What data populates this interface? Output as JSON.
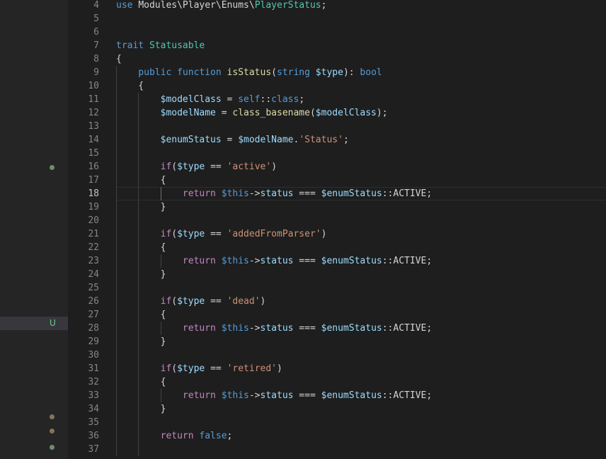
{
  "explorer": {
    "selected_status_letter": "U",
    "colors": {
      "modified": "#6b8e6b",
      "untracked": "#73c991",
      "warning": "#857458"
    }
  },
  "editor": {
    "active_line": 18,
    "lines": [
      {
        "n": "4",
        "tokens": [
          {
            "t": "use ",
            "c": "#569cd6"
          },
          {
            "t": "Modules\\Player\\Enums\\",
            "c": "#d4d4d4"
          },
          {
            "t": "PlayerStatus",
            "c": "#4ec9b0"
          },
          {
            "t": ";",
            "c": "#d4d4d4"
          }
        ]
      },
      {
        "n": "5",
        "tokens": []
      },
      {
        "n": "6",
        "tokens": []
      },
      {
        "n": "7",
        "tokens": [
          {
            "t": "trait ",
            "c": "#569cd6"
          },
          {
            "t": "Statusable",
            "c": "#4ec9b0"
          }
        ]
      },
      {
        "n": "8",
        "tokens": [
          {
            "t": "{",
            "c": "#d4d4d4"
          }
        ]
      },
      {
        "n": "9",
        "tokens": [
          {
            "t": "    public ",
            "c": "#569cd6"
          },
          {
            "t": "function ",
            "c": "#569cd6"
          },
          {
            "t": "isStatus",
            "c": "#dcdcaa"
          },
          {
            "t": "(",
            "c": "#d4d4d4"
          },
          {
            "t": "string ",
            "c": "#569cd6"
          },
          {
            "t": "$type",
            "c": "#9cdcfe"
          },
          {
            "t": "): ",
            "c": "#d4d4d4"
          },
          {
            "t": "bool",
            "c": "#569cd6"
          }
        ]
      },
      {
        "n": "10",
        "tokens": [
          {
            "t": "    {",
            "c": "#d4d4d4"
          }
        ]
      },
      {
        "n": "11",
        "tokens": [
          {
            "t": "        $modelClass",
            "c": "#9cdcfe"
          },
          {
            "t": " = ",
            "c": "#d4d4d4"
          },
          {
            "t": "self",
            "c": "#569cd6"
          },
          {
            "t": "::",
            "c": "#d4d4d4"
          },
          {
            "t": "class",
            "c": "#569cd6"
          },
          {
            "t": ";",
            "c": "#d4d4d4"
          }
        ]
      },
      {
        "n": "12",
        "tokens": [
          {
            "t": "        $modelName",
            "c": "#9cdcfe"
          },
          {
            "t": " = ",
            "c": "#d4d4d4"
          },
          {
            "t": "class_basename",
            "c": "#dcdcaa"
          },
          {
            "t": "(",
            "c": "#d4d4d4"
          },
          {
            "t": "$modelClass",
            "c": "#9cdcfe"
          },
          {
            "t": ");",
            "c": "#d4d4d4"
          }
        ]
      },
      {
        "n": "13",
        "tokens": []
      },
      {
        "n": "14",
        "tokens": [
          {
            "t": "        $enumStatus",
            "c": "#9cdcfe"
          },
          {
            "t": " = ",
            "c": "#d4d4d4"
          },
          {
            "t": "$modelName",
            "c": "#9cdcfe"
          },
          {
            "t": ".",
            "c": "#d4d4d4"
          },
          {
            "t": "'Status'",
            "c": "#ce9178"
          },
          {
            "t": ";",
            "c": "#d4d4d4"
          }
        ]
      },
      {
        "n": "15",
        "tokens": []
      },
      {
        "n": "16",
        "tokens": [
          {
            "t": "        if",
            "c": "#c586c0"
          },
          {
            "t": "(",
            "c": "#d4d4d4"
          },
          {
            "t": "$type",
            "c": "#9cdcfe"
          },
          {
            "t": " == ",
            "c": "#d4d4d4"
          },
          {
            "t": "'active'",
            "c": "#ce9178"
          },
          {
            "t": ")",
            "c": "#d4d4d4"
          }
        ]
      },
      {
        "n": "17",
        "tokens": [
          {
            "t": "        {",
            "c": "#d4d4d4"
          }
        ]
      },
      {
        "n": "18",
        "tokens": [
          {
            "t": "            return ",
            "c": "#c586c0"
          },
          {
            "t": "$this",
            "c": "#569cd6"
          },
          {
            "t": "->",
            "c": "#d4d4d4"
          },
          {
            "t": "status",
            "c": "#9cdcfe"
          },
          {
            "t": " === ",
            "c": "#d4d4d4"
          },
          {
            "t": "$enumStatus",
            "c": "#9cdcfe"
          },
          {
            "t": "::ACTIVE;",
            "c": "#d4d4d4"
          }
        ]
      },
      {
        "n": "19",
        "tokens": [
          {
            "t": "        }",
            "c": "#d4d4d4"
          }
        ]
      },
      {
        "n": "20",
        "tokens": []
      },
      {
        "n": "21",
        "tokens": [
          {
            "t": "        if",
            "c": "#c586c0"
          },
          {
            "t": "(",
            "c": "#d4d4d4"
          },
          {
            "t": "$type",
            "c": "#9cdcfe"
          },
          {
            "t": " == ",
            "c": "#d4d4d4"
          },
          {
            "t": "'addedFromParser'",
            "c": "#ce9178"
          },
          {
            "t": ")",
            "c": "#d4d4d4"
          }
        ]
      },
      {
        "n": "22",
        "tokens": [
          {
            "t": "        {",
            "c": "#d4d4d4"
          }
        ]
      },
      {
        "n": "23",
        "tokens": [
          {
            "t": "            return ",
            "c": "#c586c0"
          },
          {
            "t": "$this",
            "c": "#569cd6"
          },
          {
            "t": "->",
            "c": "#d4d4d4"
          },
          {
            "t": "status",
            "c": "#9cdcfe"
          },
          {
            "t": " === ",
            "c": "#d4d4d4"
          },
          {
            "t": "$enumStatus",
            "c": "#9cdcfe"
          },
          {
            "t": "::ACTIVE;",
            "c": "#d4d4d4"
          }
        ]
      },
      {
        "n": "24",
        "tokens": [
          {
            "t": "        }",
            "c": "#d4d4d4"
          }
        ]
      },
      {
        "n": "25",
        "tokens": []
      },
      {
        "n": "26",
        "tokens": [
          {
            "t": "        if",
            "c": "#c586c0"
          },
          {
            "t": "(",
            "c": "#d4d4d4"
          },
          {
            "t": "$type",
            "c": "#9cdcfe"
          },
          {
            "t": " == ",
            "c": "#d4d4d4"
          },
          {
            "t": "'dead'",
            "c": "#ce9178"
          },
          {
            "t": ")",
            "c": "#d4d4d4"
          }
        ]
      },
      {
        "n": "27",
        "tokens": [
          {
            "t": "        {",
            "c": "#d4d4d4"
          }
        ]
      },
      {
        "n": "28",
        "tokens": [
          {
            "t": "            return ",
            "c": "#c586c0"
          },
          {
            "t": "$this",
            "c": "#569cd6"
          },
          {
            "t": "->",
            "c": "#d4d4d4"
          },
          {
            "t": "status",
            "c": "#9cdcfe"
          },
          {
            "t": " === ",
            "c": "#d4d4d4"
          },
          {
            "t": "$enumStatus",
            "c": "#9cdcfe"
          },
          {
            "t": "::ACTIVE;",
            "c": "#d4d4d4"
          }
        ]
      },
      {
        "n": "29",
        "tokens": [
          {
            "t": "        }",
            "c": "#d4d4d4"
          }
        ]
      },
      {
        "n": "30",
        "tokens": []
      },
      {
        "n": "31",
        "tokens": [
          {
            "t": "        if",
            "c": "#c586c0"
          },
          {
            "t": "(",
            "c": "#d4d4d4"
          },
          {
            "t": "$type",
            "c": "#9cdcfe"
          },
          {
            "t": " == ",
            "c": "#d4d4d4"
          },
          {
            "t": "'retired'",
            "c": "#ce9178"
          },
          {
            "t": ")",
            "c": "#d4d4d4"
          }
        ]
      },
      {
        "n": "32",
        "tokens": [
          {
            "t": "        {",
            "c": "#d4d4d4"
          }
        ]
      },
      {
        "n": "33",
        "tokens": [
          {
            "t": "            return ",
            "c": "#c586c0"
          },
          {
            "t": "$this",
            "c": "#569cd6"
          },
          {
            "t": "->",
            "c": "#d4d4d4"
          },
          {
            "t": "status",
            "c": "#9cdcfe"
          },
          {
            "t": " === ",
            "c": "#d4d4d4"
          },
          {
            "t": "$enumStatus",
            "c": "#9cdcfe"
          },
          {
            "t": "::ACTIVE;",
            "c": "#d4d4d4"
          }
        ]
      },
      {
        "n": "34",
        "tokens": [
          {
            "t": "        }",
            "c": "#d4d4d4"
          }
        ]
      },
      {
        "n": "35",
        "tokens": []
      },
      {
        "n": "36",
        "tokens": [
          {
            "t": "        return ",
            "c": "#c586c0"
          },
          {
            "t": "false",
            "c": "#569cd6"
          },
          {
            "t": ";",
            "c": "#d4d4d4"
          }
        ]
      },
      {
        "n": "37",
        "tokens": []
      }
    ]
  }
}
